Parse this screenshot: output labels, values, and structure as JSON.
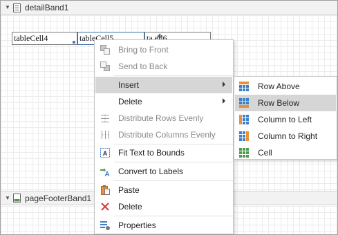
{
  "bands": {
    "detail": {
      "label": "detailBand1"
    },
    "footer": {
      "label": "pageFooterBand1 [c"
    }
  },
  "cells": {
    "c4": "tableCell4",
    "c5": "tableCell5",
    "c6": "ta   ell6"
  },
  "context_menu": {
    "items": [
      {
        "id": "bring-to-front",
        "label": "Bring to Front",
        "icon": "bring-to-front-icon",
        "disabled": true
      },
      {
        "id": "send-to-back",
        "label": "Send to Back",
        "icon": "send-to-back-icon",
        "disabled": true
      },
      {
        "id": "insert",
        "label": "Insert",
        "submenu": true,
        "highlighted": true
      },
      {
        "id": "delete-sub",
        "label": "Delete",
        "submenu": true
      },
      {
        "id": "distribute-rows",
        "label": "Distribute Rows Evenly",
        "icon": "distribute-rows-icon",
        "disabled": true
      },
      {
        "id": "distribute-columns",
        "label": "Distribute Columns Evenly",
        "icon": "distribute-columns-icon",
        "disabled": true
      },
      {
        "id": "fit-text",
        "label": "Fit Text to Bounds",
        "icon": "fit-text-icon"
      },
      {
        "id": "convert-labels",
        "label": "Convert to Labels",
        "icon": "convert-to-labels-icon"
      },
      {
        "id": "paste",
        "label": "Paste",
        "icon": "paste-icon"
      },
      {
        "id": "delete",
        "label": "Delete",
        "icon": "delete-icon"
      },
      {
        "id": "properties",
        "label": "Properties",
        "icon": "properties-icon"
      }
    ]
  },
  "insert_submenu": {
    "items": [
      {
        "id": "row-above",
        "label": "Row Above",
        "icon": "row-above-icon"
      },
      {
        "id": "row-below",
        "label": "Row Below",
        "icon": "row-below-icon",
        "highlighted": true
      },
      {
        "id": "column-left",
        "label": "Column to Left",
        "icon": "column-left-icon"
      },
      {
        "id": "column-right",
        "label": "Column to Right",
        "icon": "column-right-icon"
      },
      {
        "id": "cell",
        "label": "Cell",
        "icon": "cell-icon"
      }
    ]
  },
  "colors": {
    "highlight": "#d6d6d6",
    "delete_red": "#d83b3b",
    "table_blue": "#3f7fc6",
    "table_orange": "#e8903a",
    "table_green": "#4e9a4e"
  }
}
